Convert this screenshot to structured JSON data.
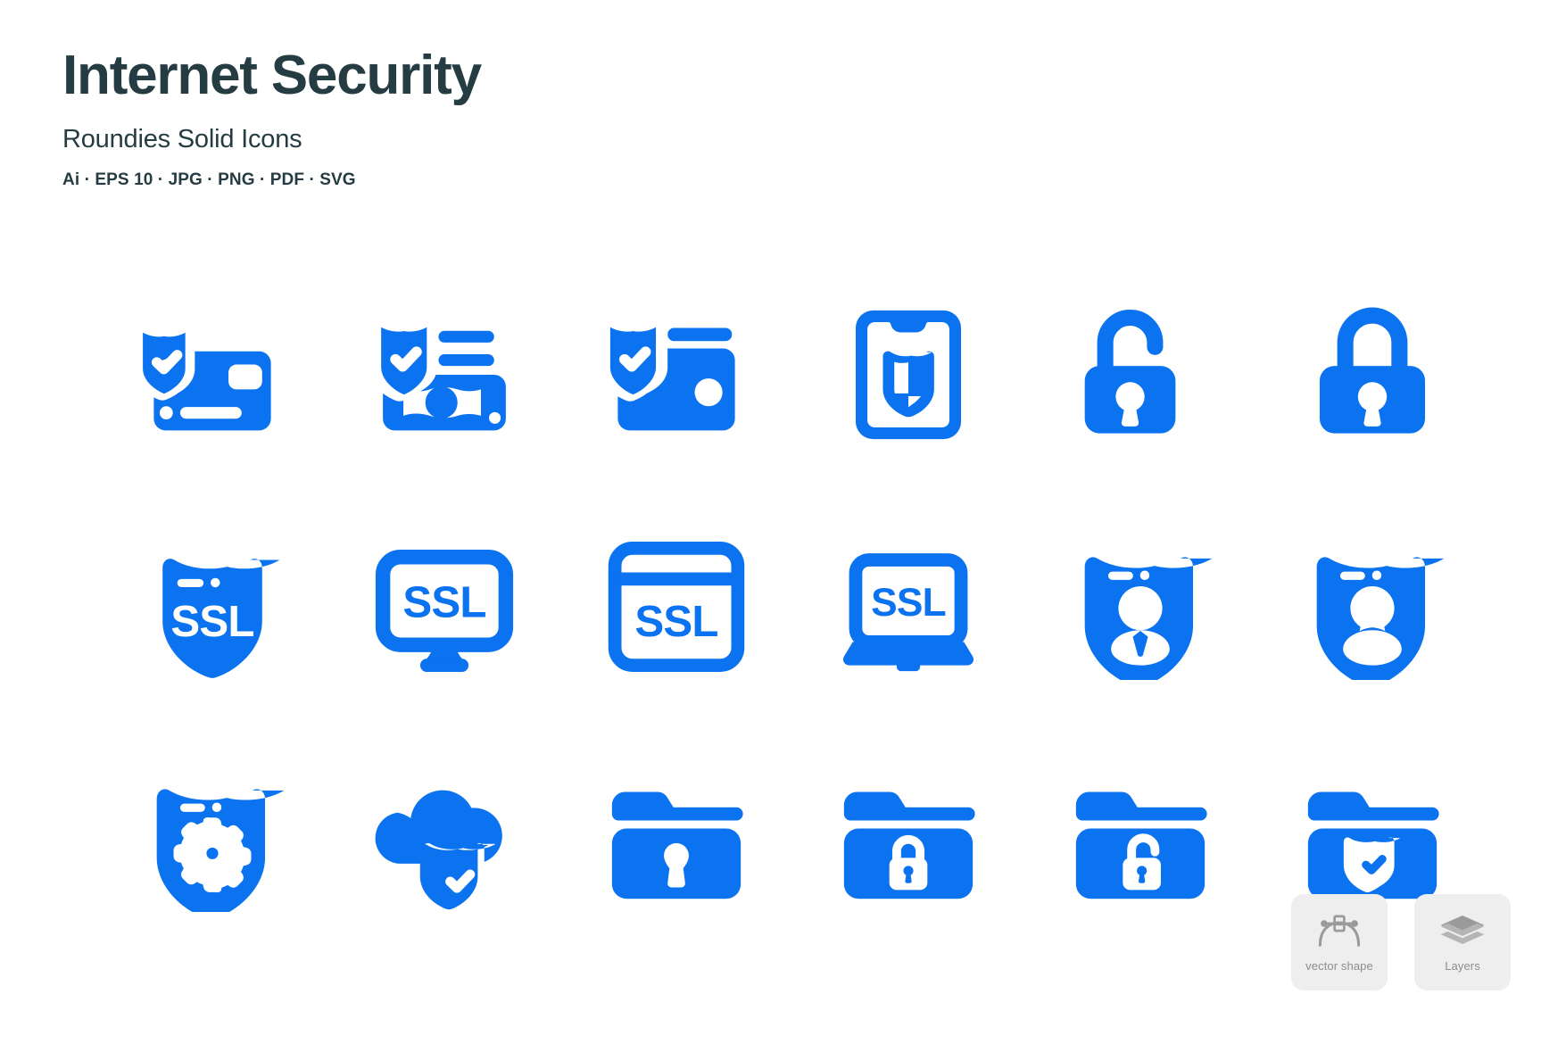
{
  "header": {
    "title": "Internet Security",
    "subtitle": "Roundies Solid Icons",
    "formats": "Ai · EPS 10 · JPG · PNG · PDF · SVG"
  },
  "colors": {
    "icon_blue": "#0b73f0",
    "title_dark": "#253c42",
    "badge_bg": "#eeeeee",
    "badge_text": "#8d8d8d",
    "page_bg": "#ffffff"
  },
  "grid": {
    "columns": 6,
    "rows": 3,
    "icons": [
      {
        "name": "credit-card-shield-icon",
        "label": "secure credit card"
      },
      {
        "name": "money-shield-icon",
        "label": "secure money"
      },
      {
        "name": "wallet-shield-icon",
        "label": "secure wallet"
      },
      {
        "name": "mobile-shield-icon",
        "label": "mobile security"
      },
      {
        "name": "unlock-icon",
        "label": "unlocked padlock"
      },
      {
        "name": "lock-icon",
        "label": "locked padlock"
      },
      {
        "name": "ssl-shield-icon",
        "label": "SSL shield",
        "text": "SSL"
      },
      {
        "name": "ssl-monitor-icon",
        "label": "SSL monitor",
        "text": "SSL"
      },
      {
        "name": "ssl-browser-icon",
        "label": "SSL browser window",
        "text": "SSL"
      },
      {
        "name": "ssl-laptop-icon",
        "label": "SSL laptop",
        "text": "SSL"
      },
      {
        "name": "user-shield-male-icon",
        "label": "protected male user"
      },
      {
        "name": "user-shield-female-icon",
        "label": "protected female user"
      },
      {
        "name": "shield-settings-icon",
        "label": "security settings"
      },
      {
        "name": "cloud-shield-check-icon",
        "label": "secure cloud"
      },
      {
        "name": "folder-keyhole-icon",
        "label": "folder with keyhole"
      },
      {
        "name": "folder-lock-icon",
        "label": "locked folder"
      },
      {
        "name": "folder-unlock-icon",
        "label": "unlocked folder"
      },
      {
        "name": "folder-shield-check-icon",
        "label": "protected folder"
      }
    ]
  },
  "badges": [
    {
      "name": "vector-shape-badge",
      "icon": "bezier-pen-icon",
      "label": "vector shape"
    },
    {
      "name": "layers-badge",
      "icon": "layers-stack-icon",
      "label": "Layers"
    }
  ]
}
